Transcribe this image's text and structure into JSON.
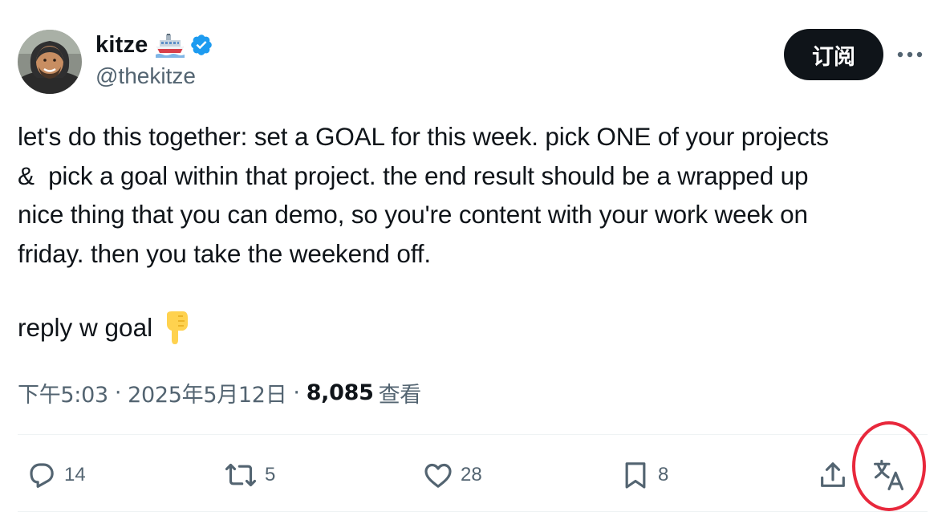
{
  "author": {
    "name": "kitze",
    "handle": "@thekitze",
    "verified": true,
    "avatar_icon": "avatar-icon",
    "name_emoji": "ship-emoji"
  },
  "header": {
    "subscribe_label": "订阅",
    "more_icon": "more-icon"
  },
  "tweet": {
    "text": "let's do this together: set a GOAL for this week. pick ONE of your projects\n&  pick a goal within that project. the end result should be a wrapped up\nnice thing that you can demo, so you're content with your work week on\nfriday. then you take the weekend off.",
    "reply_line": "reply w goal",
    "reply_emoji": "pointing-down-emoji"
  },
  "meta": {
    "time": "下午5:03",
    "date": "2025年5月12日",
    "separator": "·",
    "views_count": "8,085",
    "views_label": "查看"
  },
  "actions": {
    "reply_count": "14",
    "retweet_count": "5",
    "like_count": "28",
    "bookmark_count": "8"
  },
  "colors": {
    "text_primary": "#0f1419",
    "text_secondary": "#536471",
    "verified_blue": "#1d9bf0",
    "divider": "#eff3f4",
    "highlight_circle": "#e8283c"
  }
}
